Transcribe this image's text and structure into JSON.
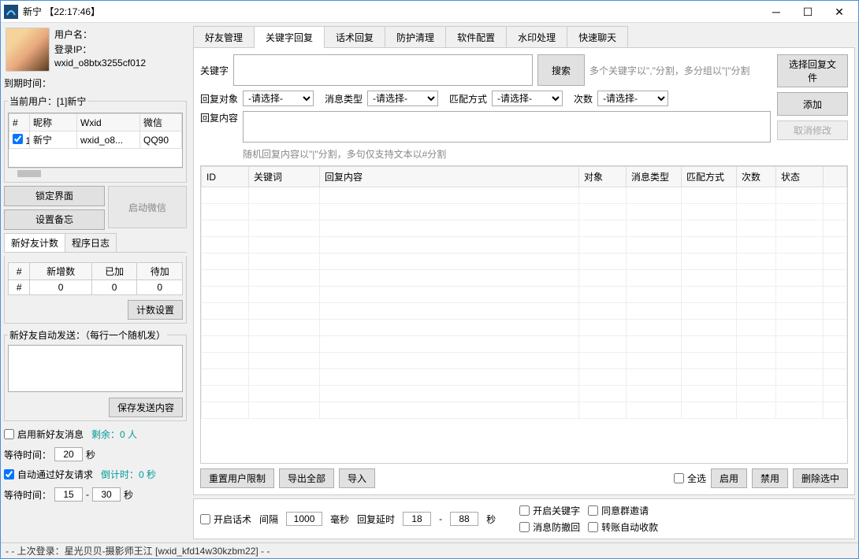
{
  "window": {
    "title": "新宁 【22:17:46】"
  },
  "sidebar": {
    "user": {
      "username_label": "用户名：",
      "ip_label": "登录IP：",
      "wxid": "wxid_o8btx3255cf012",
      "expire_label": "到期时间："
    },
    "current_user_legend": "当前用户：[1]新宁",
    "user_table": {
      "headers": {
        "num": "#",
        "nick": "昵称",
        "wxid": "Wxid",
        "wechat": "微信"
      },
      "row": {
        "num": "1",
        "nick": "新宁",
        "wxid": "wxid_o8...",
        "wechat": "QQ90"
      }
    },
    "lock_btn": "锁定界面",
    "memo_btn": "设置备忘",
    "start_btn": "启动微信",
    "mini_tabs": {
      "count": "新好友计数",
      "log": "程序日志"
    },
    "count_table": {
      "h1": "#",
      "h2": "新增数",
      "h3": "已加",
      "h4": "待加",
      "v1": "#",
      "v2": "0",
      "v3": "0",
      "v4": "0"
    },
    "count_settings_btn": "计数设置",
    "auto_send_legend": "新好友自动发送：（每行一个随机发）",
    "save_send_btn": "保存发送内容",
    "enable_new_friend": "启用新好友消息",
    "remaining": "剩余：0 人",
    "wait_label": "等待时间：",
    "wait1_value": "20",
    "sec": "秒",
    "auto_accept": "自动通过好友请求",
    "countdown": "倒计时：0 秒",
    "wait2_a": "15",
    "wait2_b": "30"
  },
  "main": {
    "tabs": {
      "t1": "好友管理",
      "t2": "关键字回复",
      "t3": "话术回复",
      "t4": "防护清理",
      "t5": "软件配置",
      "t6": "水印处理",
      "t7": "快速聊天"
    },
    "keyword_label": "关键字",
    "search_btn": "搜索",
    "hint1": "多个关键字以\",\"分割，多分组以\"|\"分割",
    "select_file_btn": "选择回复文件",
    "add_btn": "添加",
    "cancel_btn": "取消修改",
    "reply_target_label": "回复对象",
    "msg_type_label": "消息类型",
    "match_label": "匹配方式",
    "count_label": "次数",
    "select_placeholder": "-请选择-",
    "reply_content_label": "回复内容",
    "hint2": "随机回复内容以\"|\"分割，多句仅支持文本以#分割",
    "grid_headers": {
      "id": "ID",
      "kw": "关键词",
      "content": "回复内容",
      "target": "对象",
      "msgtype": "消息类型",
      "match": "匹配方式",
      "count": "次数",
      "status": "状态"
    },
    "reset_btn": "重置用户限制",
    "export_btn": "导出全部",
    "import_btn": "导入",
    "select_all": "全选",
    "enable_btn": "启用",
    "disable_btn": "禁用",
    "delete_btn": "删除选中"
  },
  "bottom": {
    "open_script": "开启话术",
    "interval_label": "间隔",
    "interval_value": "1000",
    "ms_label": "毫秒",
    "delay_label": "回复延时",
    "delay_a": "18",
    "delay_b": "88",
    "sec": "秒",
    "open_keyword": "开启关键字",
    "agree_group": "同意群邀请",
    "anti_recall": "消息防撤回",
    "auto_collect": "转账自动收款"
  },
  "status": "- -   上次登录：星光贝贝-摄影师王江 [wxid_kfd14w30kzbm22] - -"
}
